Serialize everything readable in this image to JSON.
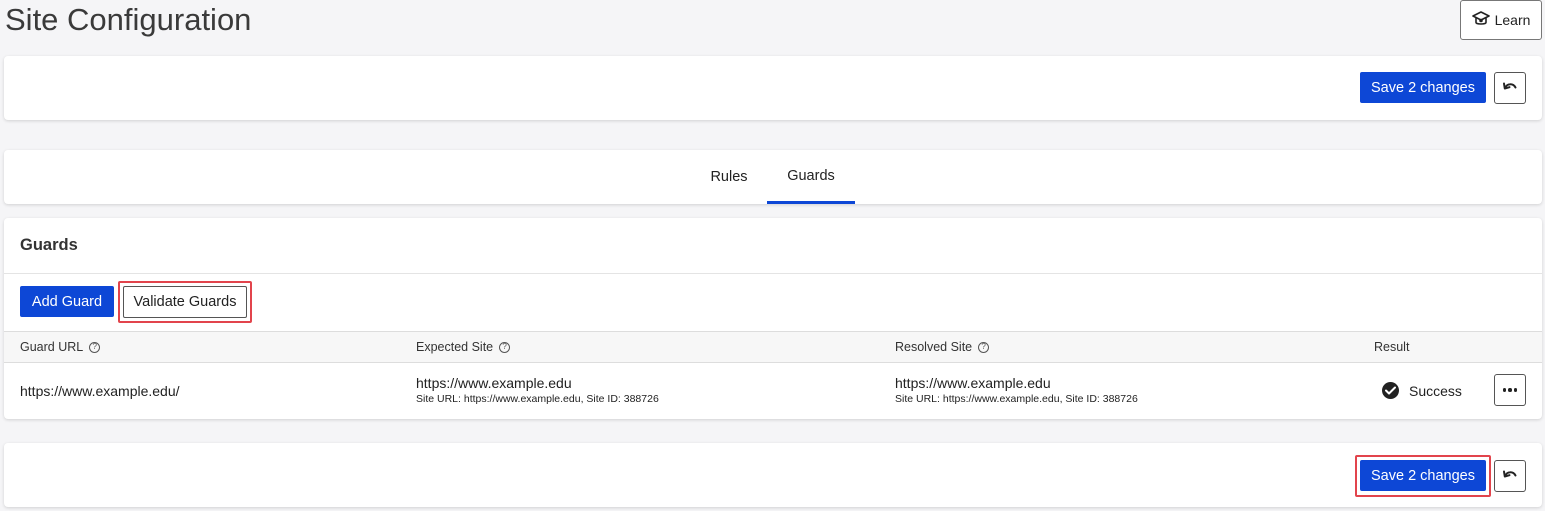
{
  "page": {
    "title": "Site Configuration",
    "learn_label": "Learn"
  },
  "top_bar": {
    "save_label": "Save 2 changes"
  },
  "tabs": [
    {
      "label": "Rules",
      "active": false
    },
    {
      "label": "Guards",
      "active": true
    }
  ],
  "guards": {
    "heading": "Guards",
    "add_label": "Add Guard",
    "validate_label": "Validate Guards",
    "columns": {
      "guard_url": "Guard URL",
      "expected_site": "Expected Site",
      "resolved_site": "Resolved Site",
      "result": "Result"
    },
    "rows": [
      {
        "guard_url": "https://www.example.edu/",
        "expected_site": "https://www.example.edu",
        "expected_detail": "Site URL: https://www.example.edu, Site ID: 388726",
        "resolved_site": "https://www.example.edu",
        "resolved_detail": "Site URL: https://www.example.edu, Site ID: 388726",
        "result": "Success"
      }
    ]
  },
  "bottom_bar": {
    "save_label": "Save 2 changes"
  },
  "colors": {
    "primary": "#0d47d6",
    "highlight": "#e2444c",
    "background": "#f5f5f7"
  }
}
